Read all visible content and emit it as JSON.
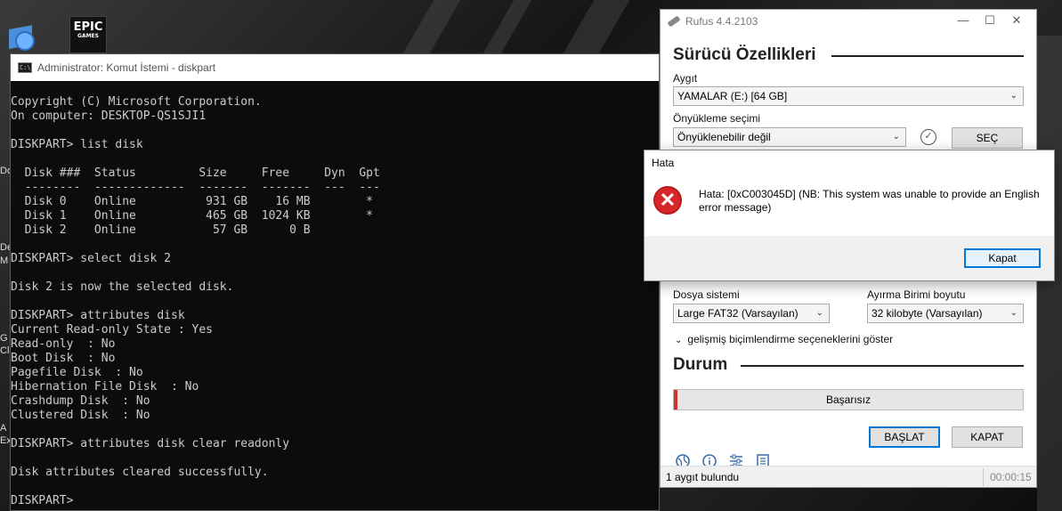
{
  "desktop": {
    "epic_label": "EPIC",
    "epic_sub": "GAMES",
    "strip_texts": [
      "Do",
      "De",
      "M",
      "G",
      "Cl",
      "A",
      "Ex"
    ]
  },
  "cmd": {
    "title": "Administrator: Komut İstemi - diskpart",
    "icon_text": "C:\\",
    "lines": [
      "Copyright (C) Microsoft Corporation.",
      "On computer: DESKTOP-QS1SJI1",
      "",
      "DISKPART> list disk",
      "",
      "  Disk ###  Status         Size     Free     Dyn  Gpt",
      "  --------  -------------  -------  -------  ---  ---",
      "  Disk 0    Online          931 GB    16 MB        *",
      "  Disk 1    Online          465 GB  1024 KB        *",
      "  Disk 2    Online           57 GB      0 B",
      "",
      "DISKPART> select disk 2",
      "",
      "Disk 2 is now the selected disk.",
      "",
      "DISKPART> attributes disk",
      "Current Read-only State : Yes",
      "Read-only  : No",
      "Boot Disk  : No",
      "Pagefile Disk  : No",
      "Hibernation File Disk  : No",
      "Crashdump Disk  : No",
      "Clustered Disk  : No",
      "",
      "DISKPART> attributes disk clear readonly",
      "",
      "Disk attributes cleared successfully.",
      "",
      "DISKPART>"
    ]
  },
  "rufus": {
    "title": "Rufus 4.4.2103",
    "section_drive": "Sürücü Özellikleri",
    "device_label": "Aygıt",
    "device_value": "YAMALAR (E:) [64 GB]",
    "boot_label": "Önyükleme seçimi",
    "boot_value": "Önyüklenebilir değil",
    "select_button": "SEÇ",
    "fs_label": "Dosya sistemi",
    "fs_value": "Large FAT32 (Varsayılan)",
    "cluster_label": "Ayırma Birimi boyutu",
    "cluster_value": "32 kilobyte (Varsayılan)",
    "advanced_toggle": "gelişmiş biçimlendirme seçeneklerini göster",
    "section_status": "Durum",
    "progress_text": "Başarısız",
    "start_button": "BAŞLAT",
    "close_button": "KAPAT",
    "status_left": "1 aygıt bulundu",
    "status_right": "00:00:15",
    "accent_color": "#d32f2f"
  },
  "dialog": {
    "title": "Hata",
    "message": "Hata: [0xC003045D] (NB: This system was unable to provide an English error message)",
    "button": "Kapat"
  }
}
